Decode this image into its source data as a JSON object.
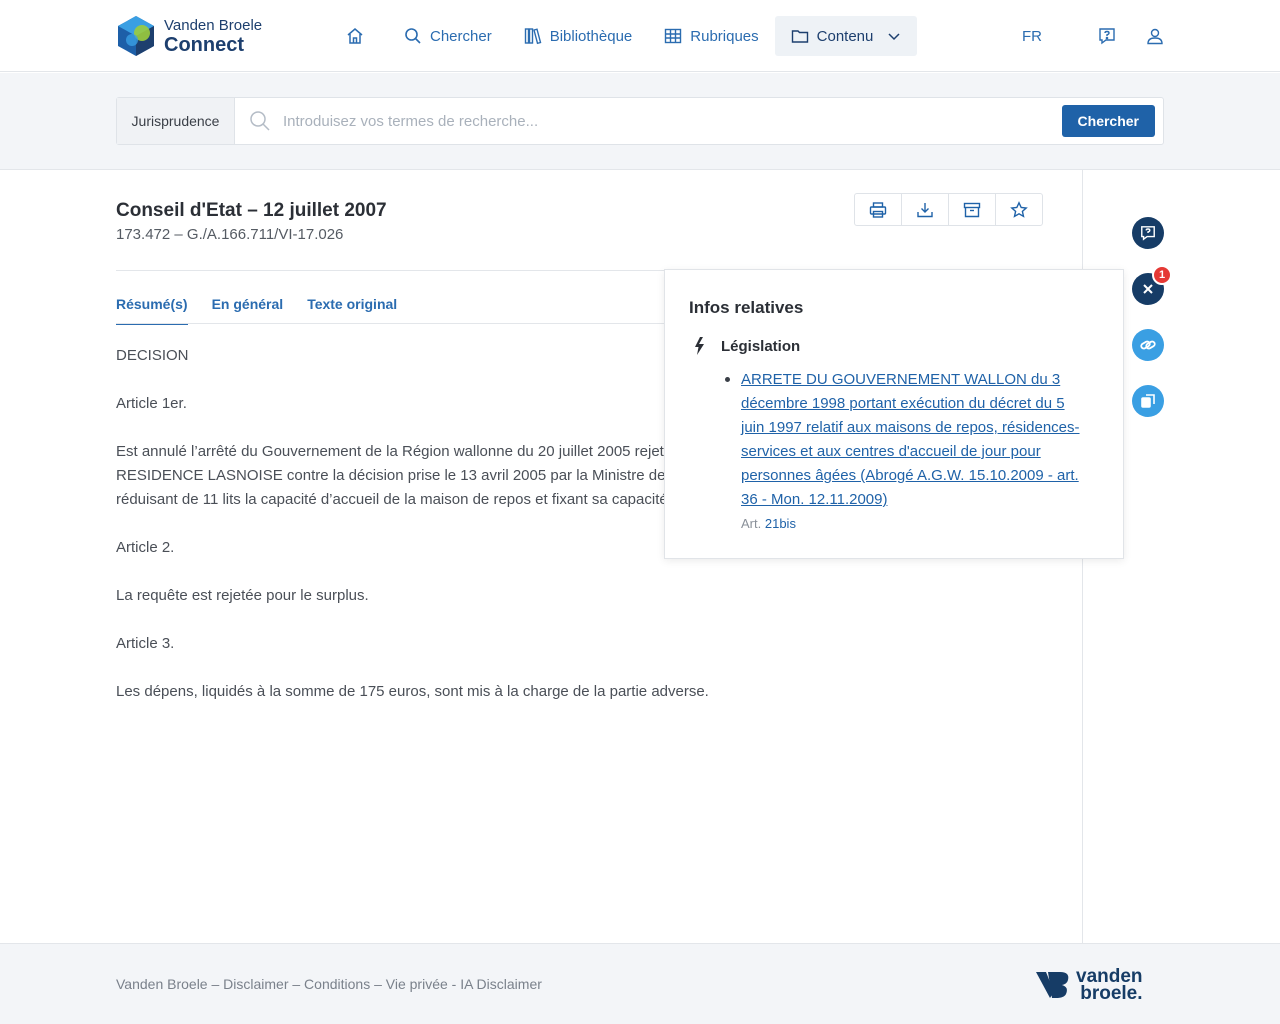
{
  "brand": {
    "line1": "Vanden Broele",
    "line2": "Connect",
    "primary_color": "#1d3f6e",
    "link_color": "#2b6cb0"
  },
  "nav": {
    "home_icon": "home-icon",
    "items": [
      {
        "label": "Chercher",
        "icon": "search-icon"
      },
      {
        "label": "Bibliothèque",
        "icon": "library-icon"
      },
      {
        "label": "Rubriques",
        "icon": "grid-icon"
      },
      {
        "label": "Contenu",
        "icon": "folder-icon"
      }
    ],
    "lang": "FR"
  },
  "search": {
    "scope": "Jurisprudence",
    "placeholder": "Introduisez vos termes de recherche...",
    "button": "Chercher"
  },
  "doc": {
    "title": "Conseil d'Etat – 12 juillet 2007",
    "subtitle": "173.472 – G./A.166.711/VI-17.026",
    "tabs": [
      "Résumé(s)",
      "En général",
      "Texte original"
    ],
    "paragraphs": [
      "DECISION",
      "Article 1er.",
      "Est annulé l’arrêté du Gouvernement de la Région wallonne du 20 juillet 2005 rejeta",
      "RESIDENCE LASNOISE contre la décision prise le 13 avril 2005 par la Ministre de la S",
      "réduisant de 11 lits la capacité d’accueil de la maison de repos et fixant sa capacité",
      "Article 2.",
      "La requête est rejetée pour le surplus.",
      "Article 3.",
      "Les dépens, liquidés à la somme de 175 euros, sont mis à la charge de la partie adverse."
    ]
  },
  "rail": {
    "badge": "1",
    "dark_color": "#163c66",
    "light_color": "#3a9fe3",
    "badge_color": "#e53935"
  },
  "popup": {
    "title": "Infos relatives",
    "section": "Législation",
    "link": "ARRETE DU GOUVERNEMENT WALLON du 3 décembre 1998 portant exécution du décret du 5 juin 1997 relatif aux maisons de repos, résidences-services et aux centres d'accueil de jour pour personnes âgées (Abrogé A.G.W. 15.10.2009 - art. 36 - Mon. 12.11.2009)",
    "art_label": "Art.",
    "art_value": "21bis"
  },
  "footer": {
    "links": "Vanden Broele – Disclaimer – Conditions – Vie privée - IA Disclaimer",
    "logo_line1": "vanden",
    "logo_line2": "broele."
  }
}
